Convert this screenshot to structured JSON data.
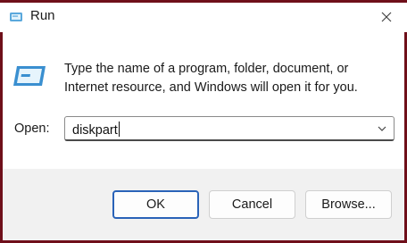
{
  "window": {
    "title": "Run",
    "accent_color": "#6f0f1a"
  },
  "content": {
    "description": "Type the name of a program, folder, document, or Internet resource, and Windows will open it for you.",
    "open_label": "Open:",
    "open_value": "diskpart"
  },
  "buttons": {
    "ok": "OK",
    "cancel": "Cancel",
    "browse": "Browse..."
  },
  "icons": {
    "title": "run-icon",
    "close": "close-icon",
    "dropdown": "chevron-down-icon"
  }
}
